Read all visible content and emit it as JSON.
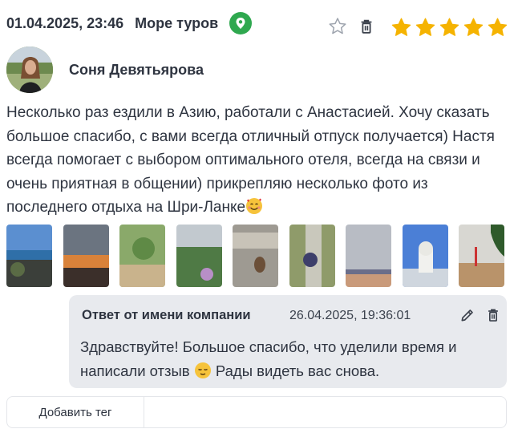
{
  "header": {
    "date": "01.04.2025, 23:46",
    "source": "Море туров",
    "source_icon": "map-pin-icon",
    "source_color": "#2fa84f"
  },
  "actions": {
    "favorite_icon": "star-outline-icon",
    "delete_icon": "trash-icon"
  },
  "rating": {
    "value": 5,
    "max": 5,
    "color": "#f5b301"
  },
  "author": {
    "name": "Соня Девятьярова",
    "avatar_icon": "avatar"
  },
  "review": {
    "text": "Несколько раз ездили в Азию, работали с Анастасией. Хочу сказать большое спасибо, с вами всегда отличный отпуск получается) Настя всегда помогает с выбором оптимального отеля, всегда на связи и очень приятная в общении) прикрепляю несколько фото из последнего отдыха на Шри-Ланке",
    "emoji": "smiling-face-with-hearts"
  },
  "photos_count": 9,
  "reply": {
    "title": "Ответ от имени компании",
    "time": "26.04.2025, 19:36:01",
    "text_before": "Здравствуйте! Большое спасибо, что уделили время и написали отзыв",
    "text_after": "Рады видеть вас снова.",
    "emoji": "relieved-face",
    "edit_icon": "pencil-icon",
    "delete_icon": "trash-icon",
    "background": "#e8eaee"
  },
  "tags": {
    "add_label": "Добавить тег"
  }
}
